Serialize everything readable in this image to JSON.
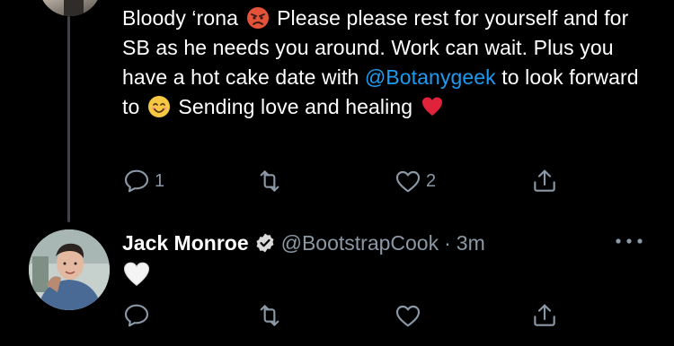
{
  "first_tweet": {
    "text_before_mention": "Bloody ‘rona",
    "text_after_angry": "Please please rest for yourself and for SB as he needs you around. Work can wait. Plus you have a hot cake date with",
    "mention": "@Botanygeek",
    "text_after_mention": "to look forward to",
    "text_after_smile": "Sending love and healing",
    "emojis": [
      "angry-face-emoji",
      "smiling-face-emoji",
      "red-heart-emoji"
    ],
    "actions": {
      "reply_count": "1",
      "retweet_count": "",
      "like_count": "2"
    }
  },
  "second_tweet": {
    "display_name": "Jack Monroe",
    "handle": "@BootstrapCook",
    "separator": "·",
    "time": "3m",
    "content_emoji": "white-heart-emoji",
    "actions": {
      "reply_count": "",
      "retweet_count": "",
      "like_count": ""
    }
  },
  "colors": {
    "background": "#000000",
    "text": "#ffffff",
    "secondary": "#8b98a5",
    "mention": "#1d9bf0",
    "thread_line": "#3d4349"
  },
  "icons": [
    "reply-icon",
    "retweet-icon",
    "like-icon",
    "share-icon",
    "verified-icon",
    "more-icon"
  ]
}
